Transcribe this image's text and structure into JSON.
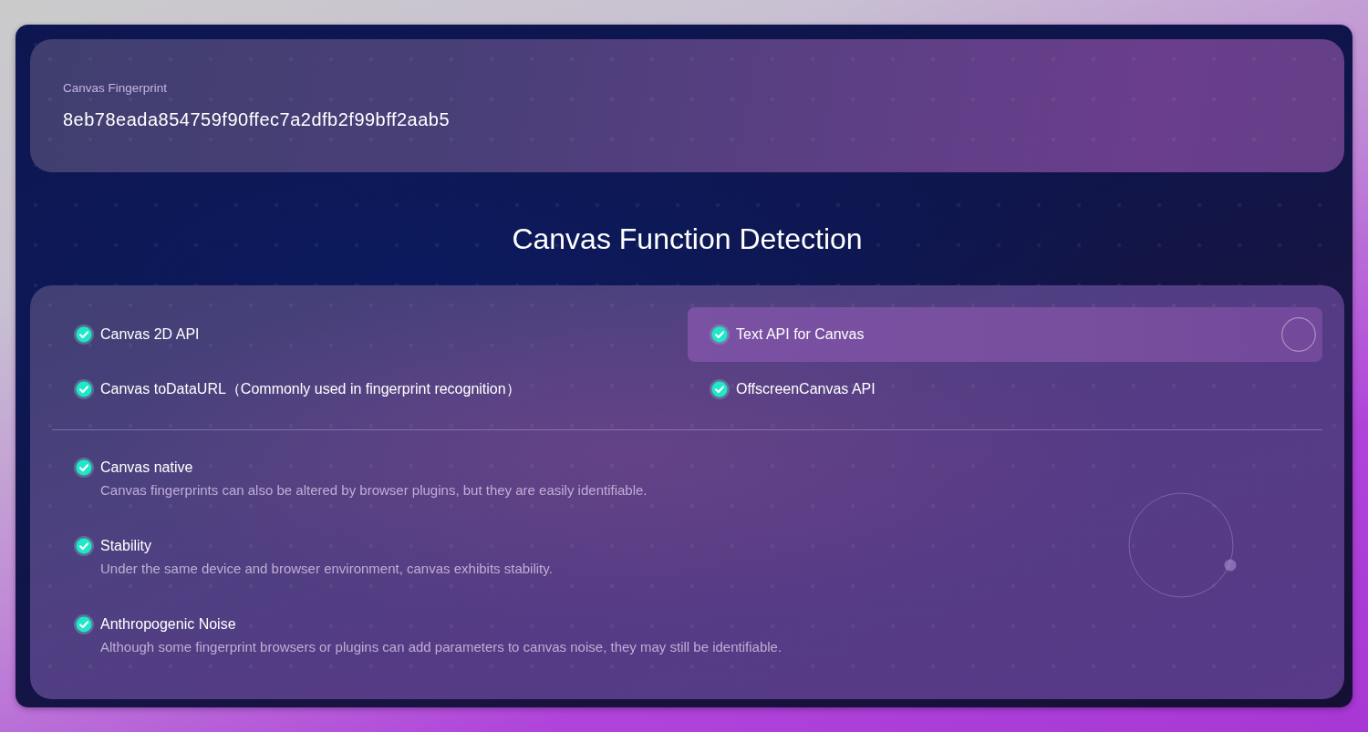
{
  "fingerprint": {
    "label": "Canvas Fingerprint",
    "value": "8eb78eada854759f90ffec7a2dfb2f99bff2aab5"
  },
  "title": "Canvas Function Detection",
  "functions": [
    {
      "label": "Canvas 2D API",
      "passed": true,
      "highlighted": false
    },
    {
      "label": "Text API for Canvas",
      "passed": true,
      "highlighted": true
    },
    {
      "label": "Canvas toDataURL（Commonly used in fingerprint recognition）",
      "passed": true,
      "highlighted": false
    },
    {
      "label": "OffscreenCanvas API",
      "passed": true,
      "highlighted": false
    }
  ],
  "features": [
    {
      "title": "Canvas native",
      "description": "Canvas fingerprints can also be altered by browser plugins, but they are easily identifiable.",
      "passed": true
    },
    {
      "title": "Stability",
      "description": "Under the same device and browser environment, canvas exhibits stability.",
      "passed": true
    },
    {
      "title": "Anthropogenic Noise",
      "description": "Although some fingerprint browsers or plugins can add parameters to canvas noise, they may still be identifiable.",
      "passed": true
    }
  ]
}
